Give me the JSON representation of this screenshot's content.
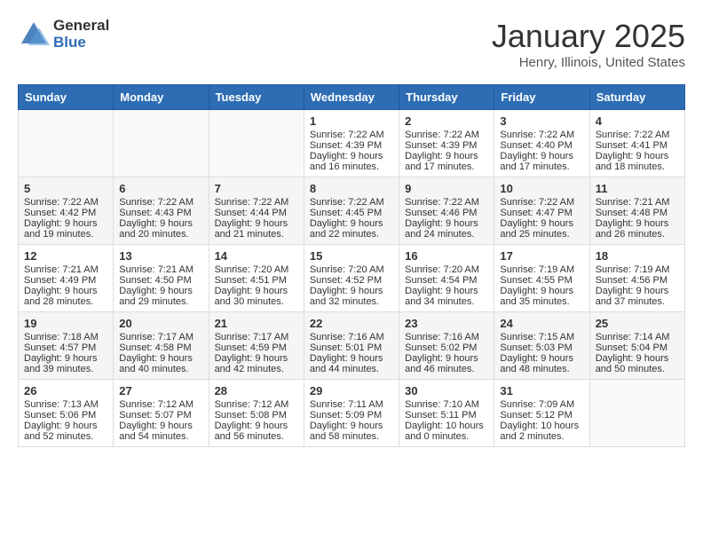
{
  "header": {
    "logo_general": "General",
    "logo_blue": "Blue",
    "title": "January 2025",
    "subtitle": "Henry, Illinois, United States"
  },
  "days_of_week": [
    "Sunday",
    "Monday",
    "Tuesday",
    "Wednesday",
    "Thursday",
    "Friday",
    "Saturday"
  ],
  "weeks": [
    [
      {
        "day": "",
        "info": ""
      },
      {
        "day": "",
        "info": ""
      },
      {
        "day": "",
        "info": ""
      },
      {
        "day": "1",
        "info": "Sunrise: 7:22 AM\nSunset: 4:39 PM\nDaylight: 9 hours\nand 16 minutes."
      },
      {
        "day": "2",
        "info": "Sunrise: 7:22 AM\nSunset: 4:39 PM\nDaylight: 9 hours\nand 17 minutes."
      },
      {
        "day": "3",
        "info": "Sunrise: 7:22 AM\nSunset: 4:40 PM\nDaylight: 9 hours\nand 17 minutes."
      },
      {
        "day": "4",
        "info": "Sunrise: 7:22 AM\nSunset: 4:41 PM\nDaylight: 9 hours\nand 18 minutes."
      }
    ],
    [
      {
        "day": "5",
        "info": "Sunrise: 7:22 AM\nSunset: 4:42 PM\nDaylight: 9 hours\nand 19 minutes."
      },
      {
        "day": "6",
        "info": "Sunrise: 7:22 AM\nSunset: 4:43 PM\nDaylight: 9 hours\nand 20 minutes."
      },
      {
        "day": "7",
        "info": "Sunrise: 7:22 AM\nSunset: 4:44 PM\nDaylight: 9 hours\nand 21 minutes."
      },
      {
        "day": "8",
        "info": "Sunrise: 7:22 AM\nSunset: 4:45 PM\nDaylight: 9 hours\nand 22 minutes."
      },
      {
        "day": "9",
        "info": "Sunrise: 7:22 AM\nSunset: 4:46 PM\nDaylight: 9 hours\nand 24 minutes."
      },
      {
        "day": "10",
        "info": "Sunrise: 7:22 AM\nSunset: 4:47 PM\nDaylight: 9 hours\nand 25 minutes."
      },
      {
        "day": "11",
        "info": "Sunrise: 7:21 AM\nSunset: 4:48 PM\nDaylight: 9 hours\nand 26 minutes."
      }
    ],
    [
      {
        "day": "12",
        "info": "Sunrise: 7:21 AM\nSunset: 4:49 PM\nDaylight: 9 hours\nand 28 minutes."
      },
      {
        "day": "13",
        "info": "Sunrise: 7:21 AM\nSunset: 4:50 PM\nDaylight: 9 hours\nand 29 minutes."
      },
      {
        "day": "14",
        "info": "Sunrise: 7:20 AM\nSunset: 4:51 PM\nDaylight: 9 hours\nand 30 minutes."
      },
      {
        "day": "15",
        "info": "Sunrise: 7:20 AM\nSunset: 4:52 PM\nDaylight: 9 hours\nand 32 minutes."
      },
      {
        "day": "16",
        "info": "Sunrise: 7:20 AM\nSunset: 4:54 PM\nDaylight: 9 hours\nand 34 minutes."
      },
      {
        "day": "17",
        "info": "Sunrise: 7:19 AM\nSunset: 4:55 PM\nDaylight: 9 hours\nand 35 minutes."
      },
      {
        "day": "18",
        "info": "Sunrise: 7:19 AM\nSunset: 4:56 PM\nDaylight: 9 hours\nand 37 minutes."
      }
    ],
    [
      {
        "day": "19",
        "info": "Sunrise: 7:18 AM\nSunset: 4:57 PM\nDaylight: 9 hours\nand 39 minutes."
      },
      {
        "day": "20",
        "info": "Sunrise: 7:17 AM\nSunset: 4:58 PM\nDaylight: 9 hours\nand 40 minutes."
      },
      {
        "day": "21",
        "info": "Sunrise: 7:17 AM\nSunset: 4:59 PM\nDaylight: 9 hours\nand 42 minutes."
      },
      {
        "day": "22",
        "info": "Sunrise: 7:16 AM\nSunset: 5:01 PM\nDaylight: 9 hours\nand 44 minutes."
      },
      {
        "day": "23",
        "info": "Sunrise: 7:16 AM\nSunset: 5:02 PM\nDaylight: 9 hours\nand 46 minutes."
      },
      {
        "day": "24",
        "info": "Sunrise: 7:15 AM\nSunset: 5:03 PM\nDaylight: 9 hours\nand 48 minutes."
      },
      {
        "day": "25",
        "info": "Sunrise: 7:14 AM\nSunset: 5:04 PM\nDaylight: 9 hours\nand 50 minutes."
      }
    ],
    [
      {
        "day": "26",
        "info": "Sunrise: 7:13 AM\nSunset: 5:06 PM\nDaylight: 9 hours\nand 52 minutes."
      },
      {
        "day": "27",
        "info": "Sunrise: 7:12 AM\nSunset: 5:07 PM\nDaylight: 9 hours\nand 54 minutes."
      },
      {
        "day": "28",
        "info": "Sunrise: 7:12 AM\nSunset: 5:08 PM\nDaylight: 9 hours\nand 56 minutes."
      },
      {
        "day": "29",
        "info": "Sunrise: 7:11 AM\nSunset: 5:09 PM\nDaylight: 9 hours\nand 58 minutes."
      },
      {
        "day": "30",
        "info": "Sunrise: 7:10 AM\nSunset: 5:11 PM\nDaylight: 10 hours\nand 0 minutes."
      },
      {
        "day": "31",
        "info": "Sunrise: 7:09 AM\nSunset: 5:12 PM\nDaylight: 10 hours\nand 2 minutes."
      },
      {
        "day": "",
        "info": ""
      }
    ]
  ]
}
